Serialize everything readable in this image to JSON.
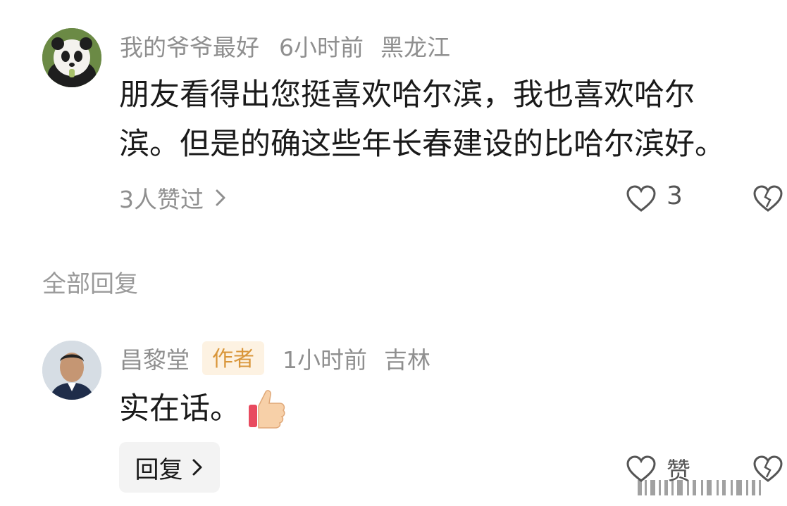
{
  "comment": {
    "username": "我的爷爷最好",
    "time": "6小时前",
    "location": "黑龙江",
    "line1": "朋友看得出您挺喜欢哈尔滨，我也喜欢哈尔",
    "line2": "滨。但是的确这些年长春建设的比哈尔滨好。",
    "likers_text": "3人赞过",
    "like_count": "3"
  },
  "replies_section": {
    "title": "全部回复"
  },
  "reply": {
    "username": "昌黎堂",
    "author_badge": "作者",
    "time": "1小时前",
    "location": "吉林",
    "text": "实在话。",
    "reply_button_label": "回复",
    "like_label": "赞"
  },
  "colors": {
    "meta_gray": "#8f8f8f",
    "text": "#1a1a1a",
    "badge_bg": "#fdf2e2",
    "badge_text": "#d9963a"
  }
}
